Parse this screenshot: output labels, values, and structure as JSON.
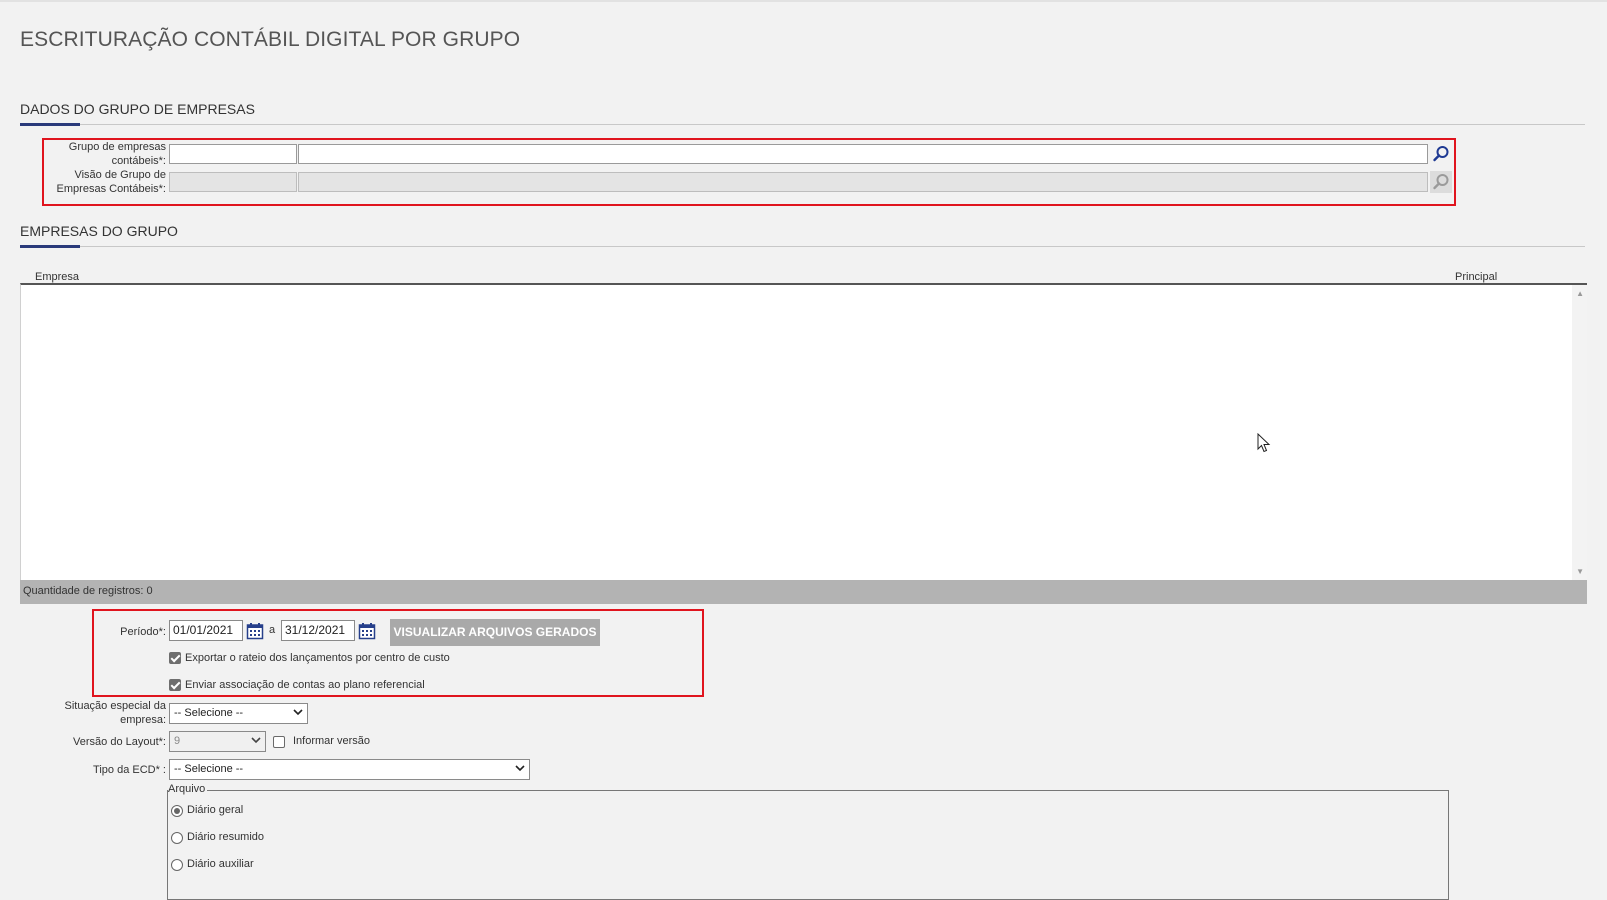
{
  "page": {
    "title": "ESCRITURAÇÃO CONTÁBIL DIGITAL POR GRUPO"
  },
  "group_data": {
    "section_title": "DADOS DO GRUPO DE EMPRESAS",
    "grupo_label_line1": "Grupo de empresas",
    "grupo_label_line2": "contábeis*:",
    "grupo_code": "",
    "grupo_name": "",
    "visao_label_line1": "Visão de Grupo de",
    "visao_label_line2": "Empresas Contábeis*:",
    "visao_code": "",
    "visao_name": "",
    "search_icon": "search-icon"
  },
  "companies": {
    "section_title": "EMPRESAS DO GRUPO",
    "columns": [
      "Empresa",
      "Principal"
    ],
    "rows": [],
    "footer": "Quantidade de registros: 0"
  },
  "period": {
    "label": "Período*:",
    "start": "01/01/2021",
    "separator": "a",
    "end": "31/12/2021",
    "view_button": "VISUALIZAR ARQUIVOS GERADOS",
    "calendar_icon": "calendar-icon"
  },
  "options": {
    "export_rateio": {
      "label": "Exportar o rateio dos lançamentos por centro de custo",
      "checked": true
    },
    "send_association": {
      "label": "Enviar associação de contas ao plano referencial",
      "checked": true
    }
  },
  "situacao": {
    "label_line1": "Situação especial da",
    "label_line2": "empresa:",
    "selected": "-- Selecione --"
  },
  "layout_version": {
    "label": "Versão do Layout*:",
    "selected": "9",
    "informar_label": "Informar versão",
    "informar_checked": false
  },
  "tipo_ecd": {
    "label": "Tipo da ECD* :",
    "selected": "-- Selecione --"
  },
  "arquivo": {
    "legend": "Arquivo",
    "options": [
      "Diário geral",
      "Diário resumido",
      "Diário auxiliar"
    ],
    "selected_index": 0
  }
}
